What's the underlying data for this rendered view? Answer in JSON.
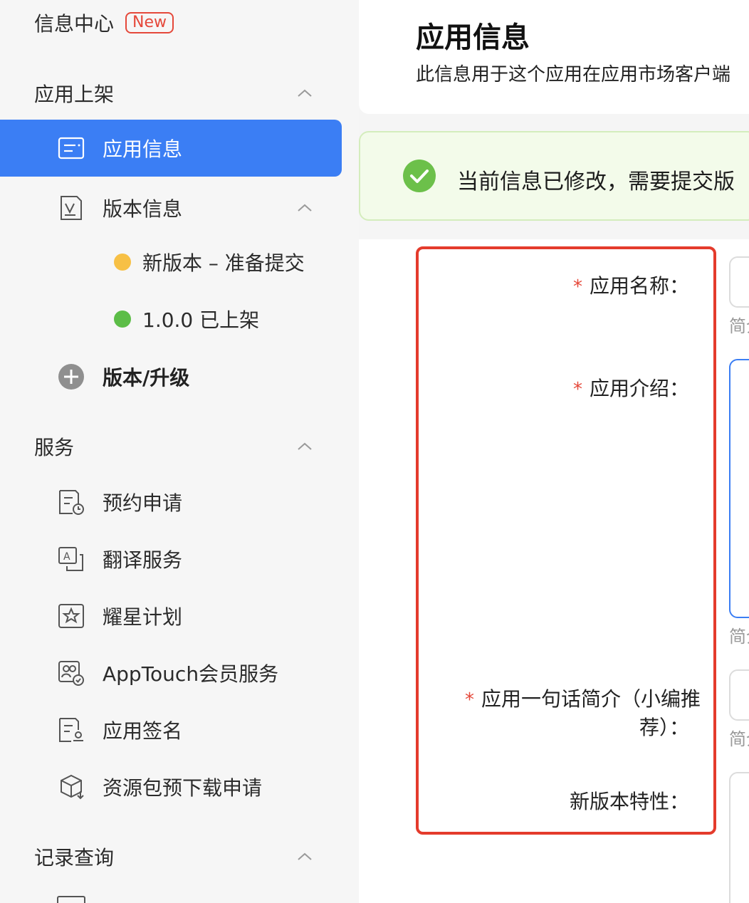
{
  "sidebar": {
    "message_center": {
      "label": "信息中心",
      "badge": "New"
    },
    "section_listing": {
      "title": "应用上架",
      "items": [
        {
          "label": "应用信息",
          "icon": "app-info-icon",
          "active": true
        },
        {
          "label": "版本信息",
          "icon": "version-info-icon"
        }
      ],
      "versions": [
        {
          "label": "新版本 – 准备提交",
          "status_color": "#f7c045"
        },
        {
          "label": "1.0.0 已上架",
          "status_color": "#5cbd47"
        }
      ],
      "add_version": {
        "label": "版本/升级",
        "icon": "plus-circle-icon"
      }
    },
    "section_service": {
      "title": "服务",
      "items": [
        {
          "label": "预约申请",
          "icon": "reservation-icon"
        },
        {
          "label": "翻译服务",
          "icon": "translate-icon"
        },
        {
          "label": "耀星计划",
          "icon": "star-plan-icon"
        },
        {
          "label": "AppTouch会员服务",
          "icon": "member-service-icon"
        },
        {
          "label": "应用签名",
          "icon": "signature-icon"
        },
        {
          "label": "资源包预下载申请",
          "icon": "package-download-icon"
        }
      ]
    },
    "section_records": {
      "title": "记录查询"
    }
  },
  "header": {
    "title": "应用信息",
    "description": "此信息用于这个应用在应用市场客户端"
  },
  "notice": {
    "text": "当前信息已修改，需要提交版",
    "icon": "check-circle-icon",
    "color": "#6cc04a"
  },
  "form": {
    "fields": [
      {
        "label": "应用名称：",
        "required": true,
        "hint": "简介"
      },
      {
        "label": "应用介绍：",
        "required": true,
        "hint": "简介"
      },
      {
        "label_line1": "应用一句话简介（小编推",
        "label_line2": "荐）：",
        "required": true,
        "hint": "简介"
      },
      {
        "label": "新版本特性：",
        "required": false
      }
    ]
  },
  "colors": {
    "accent": "#3b7ef4",
    "required": "#e5483a",
    "highlight": "#e43b2c"
  }
}
